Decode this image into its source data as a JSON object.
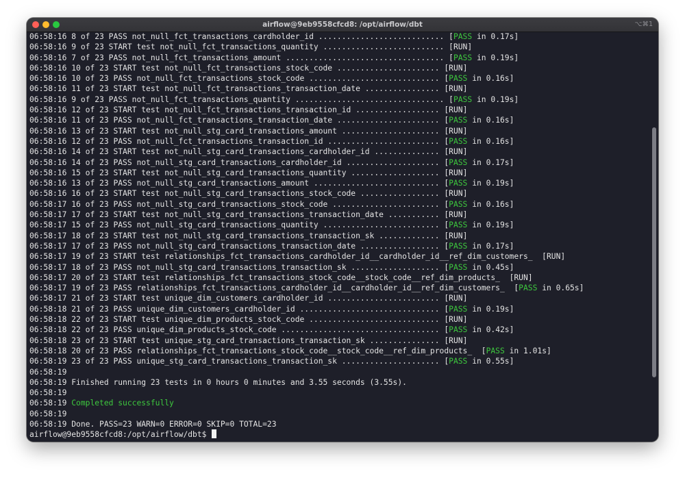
{
  "window": {
    "title": "airflow@9eb9558cfcd8: /opt/airflow/dbt",
    "shortcut": "⌥⌘1"
  },
  "terminal": {
    "lines": [
      {
        "ts": "06:58:16",
        "msg": "8 of 23 PASS not_null_fct_transactions_cardholder_id ........................... ",
        "status": "PASS",
        "time": "in 0.17s"
      },
      {
        "ts": "06:58:16",
        "msg": "9 of 23 START test not_null_fct_transactions_quantity .......................... ",
        "status": "RUN"
      },
      {
        "ts": "06:58:16",
        "msg": "7 of 23 PASS not_null_fct_transactions_amount .................................. ",
        "status": "PASS",
        "time": "in 0.19s"
      },
      {
        "ts": "06:58:16",
        "msg": "10 of 23 START test not_null_fct_transactions_stock_code ...................... ",
        "status": "RUN"
      },
      {
        "ts": "06:58:16",
        "msg": "10 of 23 PASS not_null_fct_transactions_stock_code ............................ ",
        "status": "PASS",
        "time": "in 0.16s"
      },
      {
        "ts": "06:58:16",
        "msg": "11 of 23 START test not_null_fct_transactions_transaction_date ................ ",
        "status": "RUN"
      },
      {
        "ts": "06:58:16",
        "msg": "9 of 23 PASS not_null_fct_transactions_quantity ................................ ",
        "status": "PASS",
        "time": "in 0.19s"
      },
      {
        "ts": "06:58:16",
        "msg": "12 of 23 START test not_null_fct_transactions_transaction_id .................. ",
        "status": "RUN"
      },
      {
        "ts": "06:58:16",
        "msg": "11 of 23 PASS not_null_fct_transactions_transaction_date ...................... ",
        "status": "PASS",
        "time": "in 0.16s"
      },
      {
        "ts": "06:58:16",
        "msg": "13 of 23 START test not_null_stg_card_transactions_amount ..................... ",
        "status": "RUN"
      },
      {
        "ts": "06:58:16",
        "msg": "12 of 23 PASS not_null_fct_transactions_transaction_id ........................ ",
        "status": "PASS",
        "time": "in 0.16s"
      },
      {
        "ts": "06:58:16",
        "msg": "14 of 23 START test not_null_stg_card_transactions_cardholder_id .............. ",
        "status": "RUN"
      },
      {
        "ts": "06:58:16",
        "msg": "14 of 23 PASS not_null_stg_card_transactions_cardholder_id .................... ",
        "status": "PASS",
        "time": "in 0.17s"
      },
      {
        "ts": "06:58:16",
        "msg": "15 of 23 START test not_null_stg_card_transactions_quantity ................... ",
        "status": "RUN"
      },
      {
        "ts": "06:58:16",
        "msg": "13 of 23 PASS not_null_stg_card_transactions_amount ........................... ",
        "status": "PASS",
        "time": "in 0.19s"
      },
      {
        "ts": "06:58:16",
        "msg": "16 of 23 START test not_null_stg_card_transactions_stock_code ................. ",
        "status": "RUN"
      },
      {
        "ts": "06:58:17",
        "msg": "16 of 23 PASS not_null_stg_card_transactions_stock_code ....................... ",
        "status": "PASS",
        "time": "in 0.16s"
      },
      {
        "ts": "06:58:17",
        "msg": "17 of 23 START test not_null_stg_card_transactions_transaction_date ........... ",
        "status": "RUN"
      },
      {
        "ts": "06:58:17",
        "msg": "15 of 23 PASS not_null_stg_card_transactions_quantity ......................... ",
        "status": "PASS",
        "time": "in 0.19s"
      },
      {
        "ts": "06:58:17",
        "msg": "18 of 23 START test not_null_stg_card_transactions_transaction_sk ............. ",
        "status": "RUN"
      },
      {
        "ts": "06:58:17",
        "msg": "17 of 23 PASS not_null_stg_card_transactions_transaction_date ................. ",
        "status": "PASS",
        "time": "in 0.17s"
      },
      {
        "ts": "06:58:17",
        "msg": "19 of 23 START test relationships_fct_transactions_cardholder_id__cardholder_id__ref_dim_customers_  ",
        "status": "RUN"
      },
      {
        "ts": "06:58:17",
        "msg": "18 of 23 PASS not_null_stg_card_transactions_transaction_sk ................... ",
        "status": "PASS",
        "time": "in 0.45s"
      },
      {
        "ts": "06:58:17",
        "msg": "20 of 23 START test relationships_fct_transactions_stock_code__stock_code__ref_dim_products_  ",
        "status": "RUN"
      },
      {
        "ts": "06:58:17",
        "msg": "19 of 23 PASS relationships_fct_transactions_cardholder_id__cardholder_id__ref_dim_customers_  ",
        "status": "PASS",
        "time": "in 0.65s"
      },
      {
        "ts": "06:58:17",
        "msg": "21 of 23 START test unique_dim_customers_cardholder_id ........................ ",
        "status": "RUN"
      },
      {
        "ts": "06:58:18",
        "msg": "21 of 23 PASS unique_dim_customers_cardholder_id .............................. ",
        "status": "PASS",
        "time": "in 0.19s"
      },
      {
        "ts": "06:58:18",
        "msg": "22 of 23 START test unique_dim_products_stock_code ............................ ",
        "status": "RUN"
      },
      {
        "ts": "06:58:18",
        "msg": "22 of 23 PASS unique_dim_products_stock_code .................................. ",
        "status": "PASS",
        "time": "in 0.42s"
      },
      {
        "ts": "06:58:18",
        "msg": "23 of 23 START test unique_stg_card_transactions_transaction_sk ............... ",
        "status": "RUN"
      },
      {
        "ts": "06:58:18",
        "msg": "20 of 23 PASS relationships_fct_transactions_stock_code__stock_code__ref_dim_products_  ",
        "status": "PASS",
        "time": "in 1.01s"
      },
      {
        "ts": "06:58:19",
        "msg": "23 of 23 PASS unique_stg_card_transactions_transaction_sk ..................... ",
        "status": "PASS",
        "time": "in 0.55s"
      },
      {
        "ts": "06:58:19",
        "msg": ""
      },
      {
        "ts": "06:58:19",
        "msg": "Finished running 23 tests in 0 hours 0 minutes and 3.55 seconds (3.55s)."
      },
      {
        "ts": "06:58:19",
        "msg": ""
      },
      {
        "ts": "06:58:19",
        "msg": "Completed successfully",
        "color": "green"
      },
      {
        "ts": "06:58:19",
        "msg": ""
      },
      {
        "ts": "06:58:19",
        "msg": "Done. PASS=23 WARN=0 ERROR=0 SKIP=0 TOTAL=23"
      }
    ],
    "prompt": "airflow@9eb9558cfcd8:/opt/airflow/dbt$ ",
    "scroll_position": 0.6
  },
  "colors": {
    "background": "#1e1f29",
    "text": "#e4e4e4",
    "pass_green": "#3ec93e"
  }
}
